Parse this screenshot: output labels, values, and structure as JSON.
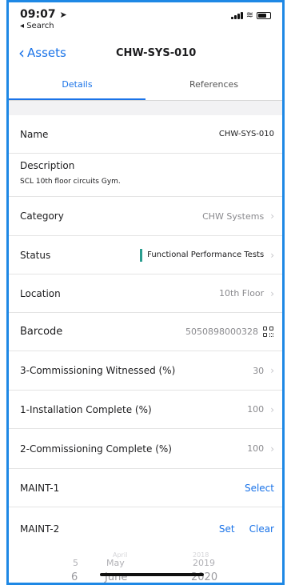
{
  "status_bar": {
    "time": "09:07",
    "back_app": "◂ Search"
  },
  "nav": {
    "back_label": "Assets",
    "title": "CHW-SYS-010"
  },
  "tabs": [
    {
      "label": "Details"
    },
    {
      "label": "References"
    }
  ],
  "details": {
    "name": {
      "label": "Name",
      "value": "CHW-SYS-010"
    },
    "description": {
      "label": "Description",
      "value": "SCL 10th floor circuits Gym."
    },
    "category": {
      "label": "Category",
      "value": "CHW Systems"
    },
    "status": {
      "label": "Status",
      "value": "Functional Performance Tests",
      "color": "#2a9d8f"
    },
    "location": {
      "label": "Location",
      "value": "10th Floor"
    },
    "barcode": {
      "label": "Barcode",
      "value": "5050898000328",
      "icon": "qr-code-icon"
    },
    "commissioning_witnessed": {
      "label": "3-Commissioning Witnessed (%)",
      "value": "30"
    },
    "installation_complete": {
      "label": "1-Installation Complete (%)",
      "value": "100"
    },
    "commissioning_complete": {
      "label": "2-Commissioning Complete (%)",
      "value": "100"
    },
    "maint1": {
      "label": "MAINT-1",
      "action": "Select"
    },
    "maint2": {
      "label": "MAINT-2",
      "set": "Set",
      "clear": "Clear"
    }
  },
  "picker": {
    "day_prev": "5",
    "day_cur": "6",
    "month_top": "April",
    "month_prev": "May",
    "month_cur": "June",
    "year_top": "2018",
    "year_prev": "2019",
    "year_cur": "2020"
  },
  "colors": {
    "accent": "#1a73e8",
    "frame": "#1e88e5"
  }
}
